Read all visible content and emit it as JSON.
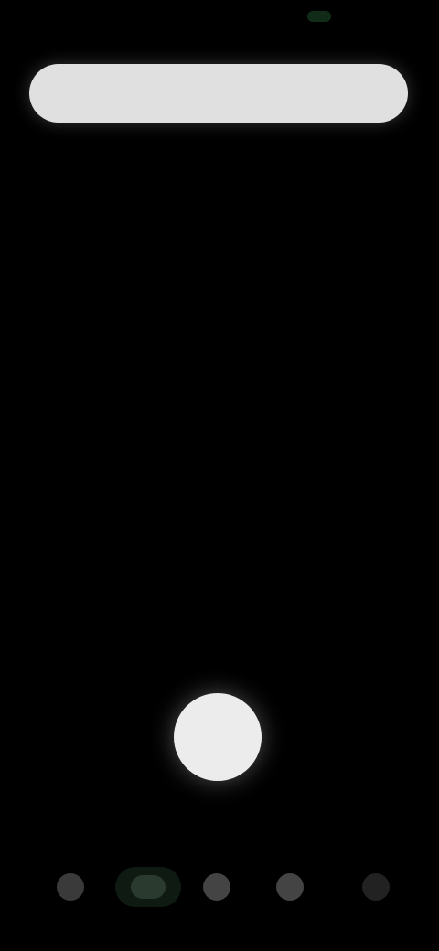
{
  "status_bar": {
    "time": "",
    "indicator_color": "#1a4a2a"
  },
  "top_bar": {
    "text": ""
  },
  "center": {
    "text": ""
  },
  "main_button": {
    "icon": "shutter-icon"
  },
  "bottom_nav": {
    "items": [
      {
        "icon": "nav-icon-1",
        "label": ""
      },
      {
        "icon": "nav-icon-2",
        "label": "",
        "active": true
      },
      {
        "icon": "nav-icon-3",
        "label": ""
      },
      {
        "icon": "nav-icon-4",
        "label": ""
      },
      {
        "icon": "nav-icon-5",
        "label": ""
      }
    ]
  },
  "colors": {
    "background": "#000000",
    "top_bar": "#e0e0e0",
    "main_button": "#ececec",
    "active_nav": "#0e1a12"
  }
}
